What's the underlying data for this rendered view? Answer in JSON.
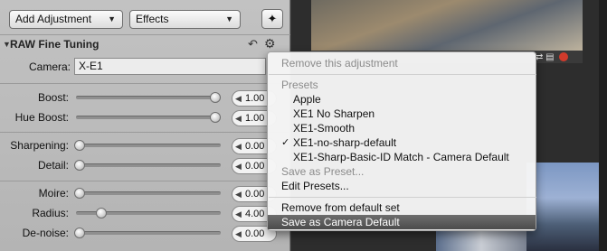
{
  "toolbar": {
    "add_adjustment": "Add Adjustment",
    "effects": "Effects"
  },
  "section": {
    "title": "RAW Fine Tuning",
    "camera_label": "Camera:",
    "camera_value": "X-E1"
  },
  "sliders": [
    {
      "label": "Boost:",
      "value": "1.00",
      "level": 1.0
    },
    {
      "label": "Hue Boost:",
      "value": "1.00",
      "level": 1.0
    },
    {
      "label": "Sharpening:",
      "value": "0.00",
      "level": 0.0
    },
    {
      "label": "Detail:",
      "value": "0.00",
      "level": 0.0
    },
    {
      "label": "Moire:",
      "value": "0.00",
      "level": 0.0
    },
    {
      "label": "Radius:",
      "value": "4.00",
      "level": 0.16
    },
    {
      "label": "De-noise:",
      "value": "0.00",
      "level": 0.0
    }
  ],
  "menu": {
    "remove_adjustment": "Remove this adjustment",
    "presets_header": "Presets",
    "presets": [
      {
        "label": "Apple",
        "checked": false
      },
      {
        "label": "XE1 No Sharpen",
        "checked": false
      },
      {
        "label": "XE1-Smooth",
        "checked": false
      },
      {
        "label": "XE1-no-sharp-default",
        "checked": true
      },
      {
        "label": "XE1-Sharp-Basic-ID Match  - Camera Default",
        "checked": false
      }
    ],
    "save_as_preset": "Save as Preset...",
    "edit_presets": "Edit Presets...",
    "remove_from_default": "Remove from default set",
    "save_camera_default": "Save as Camera Default",
    "check_mark": "✓"
  },
  "colors": {
    "panel_bg": "#bcbcbc",
    "highlight": "#5a5a5a",
    "close_dot": "#d23b2b"
  }
}
